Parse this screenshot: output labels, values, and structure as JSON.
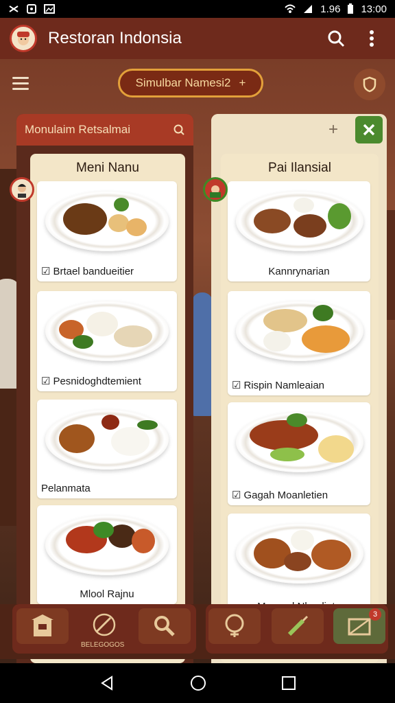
{
  "status": {
    "battery": "1.96",
    "time": "13:00"
  },
  "app": {
    "title": "Restoran Indonsia"
  },
  "toolbar": {
    "sim_label": "Simulbar Namesi2",
    "sim_arrow": "+"
  },
  "left_panel": {
    "header": "Monulaim Retsalmai",
    "column_title": "Meni Nanu",
    "cards": [
      {
        "label": "Brtael bandueitier",
        "checked": true
      },
      {
        "label": "Pesnidoghdtemient",
        "checked": true
      },
      {
        "label": "Pelanmata",
        "checked": false
      },
      {
        "label": "Mlool Rajnu",
        "checked": false
      }
    ]
  },
  "right_panel": {
    "plus": "+",
    "column_title": "Pai Ilansial",
    "cards": [
      {
        "label": "Kannrynarian",
        "checked": false
      },
      {
        "label": "Rispin Namleaian",
        "checked": true
      },
      {
        "label": "Gagah Moanletien",
        "checked": true
      },
      {
        "label": "Mapreal Nlaodiatn",
        "checked": false
      }
    ]
  },
  "tray": {
    "left_label": "BELEGOGOS",
    "badge_count": "3"
  },
  "icons": [
    "wifi-icon",
    "signal-icon",
    "battery-icon",
    "search-icon",
    "more-icon",
    "menu-icon",
    "shield-icon",
    "close-icon",
    "plus-icon",
    "back-icon",
    "home-icon",
    "recents-icon"
  ]
}
